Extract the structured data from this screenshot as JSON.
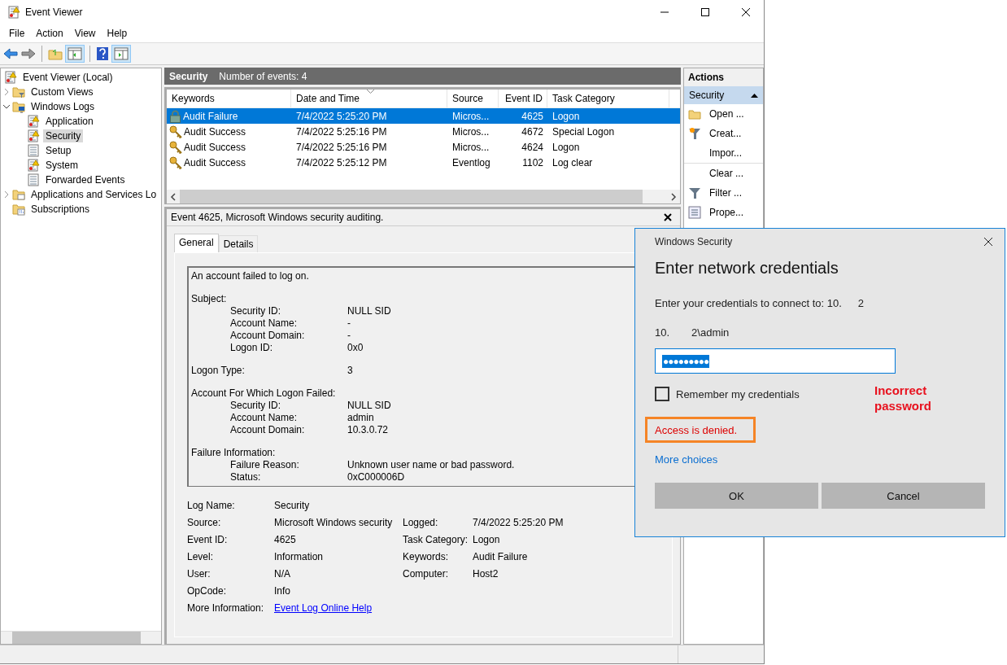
{
  "window": {
    "title": "Event Viewer"
  },
  "menu": [
    "File",
    "Action",
    "View",
    "Help"
  ],
  "tree": [
    {
      "label": "Event Viewer (Local)",
      "kind": "viewer",
      "selected": false,
      "children": [
        {
          "label": "Custom Views",
          "kind": "folder-filter",
          "expanded": false,
          "selected": false
        },
        {
          "label": "Windows Logs",
          "kind": "folder-computer",
          "expanded": true,
          "selected": false,
          "children": [
            {
              "label": "Application",
              "kind": "log-warning",
              "selected": false
            },
            {
              "label": "Security",
              "kind": "log-warning",
              "selected": true
            },
            {
              "label": "Setup",
              "kind": "log",
              "selected": false
            },
            {
              "label": "System",
              "kind": "log-warning",
              "selected": false
            },
            {
              "label": "Forwarded Events",
              "kind": "log",
              "selected": false
            }
          ]
        },
        {
          "label": "Applications and Services Lo",
          "kind": "folder",
          "expanded": false,
          "selected": false
        },
        {
          "label": "Subscriptions",
          "kind": "subscriptions",
          "selected": false
        }
      ]
    }
  ],
  "log_header": {
    "title": "Security",
    "count": "Number of events: 4"
  },
  "events": {
    "columns": [
      "Keywords",
      "Date and Time",
      "Source",
      "Event ID",
      "Task Category"
    ],
    "rows": [
      {
        "kind": "lock",
        "keywords": "Audit Failure",
        "date": "7/4/2022 5:25:20 PM",
        "source": "Micros...",
        "event_id": "4625",
        "category": "Logon",
        "selected": true
      },
      {
        "kind": "key",
        "keywords": "Audit Success",
        "date": "7/4/2022 5:25:16 PM",
        "source": "Micros...",
        "event_id": "4672",
        "category": "Special Logon",
        "selected": false
      },
      {
        "kind": "key",
        "keywords": "Audit Success",
        "date": "7/4/2022 5:25:16 PM",
        "source": "Micros...",
        "event_id": "4624",
        "category": "Logon",
        "selected": false
      },
      {
        "kind": "key",
        "keywords": "Audit Success",
        "date": "7/4/2022 5:25:12 PM",
        "source": "Eventlog",
        "event_id": "1102",
        "category": "Log clear",
        "selected": false
      }
    ]
  },
  "detail": {
    "title": "Event 4625, Microsoft Windows security auditing.",
    "tabs": [
      {
        "label": "General",
        "selected": true
      },
      {
        "label": "Details",
        "selected": false
      }
    ],
    "description": [
      {
        "heading": "An account failed to log on."
      },
      {
        "heading": "Subject:",
        "fields": [
          {
            "label": "Security ID:",
            "value": "NULL SID"
          },
          {
            "label": "Account Name:",
            "value": "-"
          },
          {
            "label": "Account Domain:",
            "value": "-"
          },
          {
            "label": "Logon ID:",
            "value": "0x0"
          }
        ]
      },
      {
        "heading": "Logon Type:",
        "value": "3"
      },
      {
        "heading": "Account For Which Logon Failed:",
        "fields": [
          {
            "label": "Security ID:",
            "value": "NULL SID"
          },
          {
            "label": "Account Name:",
            "value": "admin"
          },
          {
            "label": "Account Domain:",
            "value": "10.3.0.72"
          }
        ]
      },
      {
        "heading": "Failure Information:",
        "fields": [
          {
            "label": "Failure Reason:",
            "value": "Unknown user name or bad password."
          },
          {
            "label": "Status:",
            "value": "0xC000006D"
          }
        ]
      }
    ],
    "properties": [
      {
        "label": "Log Name:",
        "value": "Security"
      },
      {
        "label": "Source:",
        "value": "Microsoft Windows security",
        "label2": "Logged:",
        "value2": "7/4/2022 5:25:20 PM"
      },
      {
        "label": "Event ID:",
        "value": "4625",
        "label2": "Task Category:",
        "value2": "Logon"
      },
      {
        "label": "Level:",
        "value": "Information",
        "label2": "Keywords:",
        "value2": "Audit Failure"
      },
      {
        "label": "User:",
        "value": "N/A",
        "label2": "Computer:",
        "value2": "Host2"
      },
      {
        "label": "OpCode:",
        "value": "Info"
      },
      {
        "label": "More Information:",
        "link": "Event Log Online Help"
      }
    ]
  },
  "actions": {
    "title": "Actions",
    "section": "Security",
    "groups": [
      [
        {
          "label": "Open ...",
          "kind": "folder"
        },
        {
          "label": "Creat...",
          "kind": "funnel-star"
        },
        {
          "label": "Impor...",
          "kind": "none"
        }
      ],
      [
        {
          "label": "Clear ...",
          "kind": "none"
        },
        {
          "label": "Filter ...",
          "kind": "funnel"
        },
        {
          "label": "Prope...",
          "kind": "properties"
        }
      ]
    ]
  },
  "dialog": {
    "title": "Windows Security",
    "heading": "Enter network credentials",
    "prompt": "Enter your credentials to connect to: 10.",
    "prompt_tail": "2",
    "user_prefix": "10.",
    "user": "2\\admin",
    "password": "●●●●●●●●●",
    "remember": {
      "label": "Remember my credentials",
      "checked": false
    },
    "error": "Access is denied.",
    "more": "More choices",
    "buttons": [
      "OK",
      "Cancel"
    ]
  },
  "annotation": "Incorrect password"
}
